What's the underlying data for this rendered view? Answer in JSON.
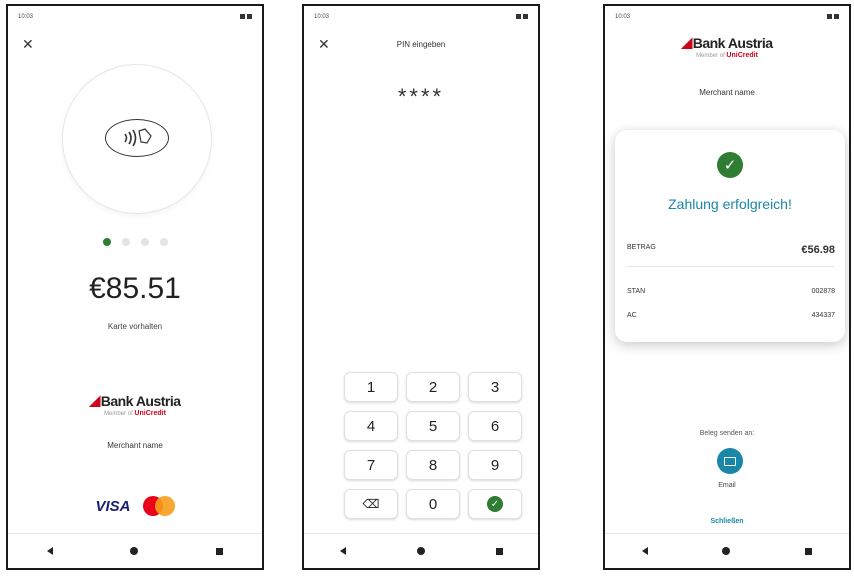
{
  "screen1": {
    "status_time": "10:03",
    "amount": "€85.51",
    "hint": "Karte vorhalten",
    "brand": "Bank Austria",
    "brand_sub_prefix": "Member of",
    "brand_sub": "UniCredit",
    "merchant": "Merchant name",
    "visa": "VISA",
    "close_symbol": "✕",
    "step_dots": 4,
    "active_dot": 1
  },
  "screen2": {
    "status_time": "10:03",
    "title": "PIN eingeben",
    "pin": "****",
    "close_symbol": "✕",
    "keys": [
      "1",
      "2",
      "3",
      "4",
      "5",
      "6",
      "7",
      "8",
      "9",
      "⌫",
      "0",
      "✓"
    ]
  },
  "screen3": {
    "status_time": "10:03",
    "brand": "Bank Austria",
    "brand_sub_prefix": "Member of",
    "brand_sub": "UniCredit",
    "merchant": "Merchant name",
    "success": "Zahlung erfolgreich!",
    "betrag_label": "BETRAG",
    "betrag_value": "€56.98",
    "stan_label": "STAN",
    "stan_value": "002878",
    "ac_label": "AC",
    "ac_value": "434337",
    "send_label": "Beleg senden an:",
    "email_label": "Email",
    "close_label": "Schließen"
  },
  "colors": {
    "green": "#2e7d32",
    "teal": "#1a86a8",
    "brand_red": "#d0021b"
  }
}
